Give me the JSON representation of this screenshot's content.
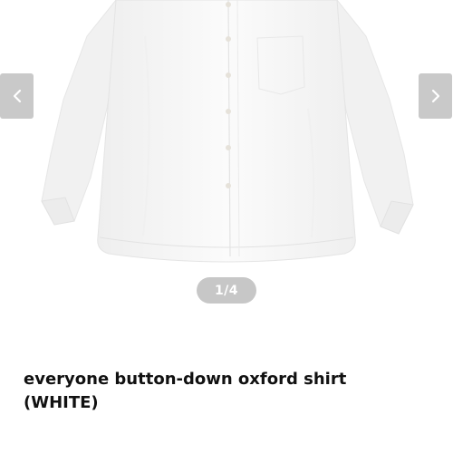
{
  "gallery": {
    "image_alt": "white button-down oxford shirt",
    "current_page": 1,
    "total_pages": 4,
    "indicator_text": "1/4",
    "prev_icon": "chevron-left-icon",
    "next_icon": "chevron-right-icon"
  },
  "product": {
    "title_line1": "everyone button-down oxford shirt",
    "title_line2": "(WHITE)"
  },
  "colors": {
    "nav_button_bg": "#c9c9c9",
    "indicator_bg": "#c7c7c7",
    "title_text": "#111111"
  }
}
